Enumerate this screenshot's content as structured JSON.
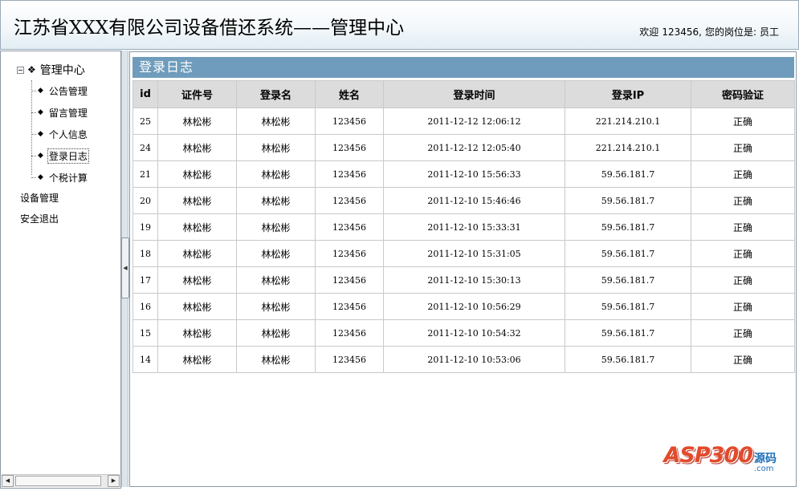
{
  "header": {
    "title": "江苏省XXX有限公司设备借还系统——管理中心",
    "welcome_prefix": "欢迎",
    "username": "123456,",
    "role_label": "您的岗位是:",
    "role_value": "员工"
  },
  "sidebar": {
    "root_label": "管理中心",
    "items": [
      {
        "label": "公告管理",
        "selected": false
      },
      {
        "label": "留言管理",
        "selected": false
      },
      {
        "label": "个人信息",
        "selected": false
      },
      {
        "label": "登录日志",
        "selected": true
      },
      {
        "label": "个税计算",
        "selected": false
      }
    ],
    "top_items": [
      "设备管理",
      "安全退出"
    ]
  },
  "main": {
    "section_title": "登录日志",
    "table": {
      "columns": [
        "id",
        "证件号",
        "登录名",
        "姓名",
        "登录时间",
        "登录IP",
        "密码验证"
      ],
      "rows": [
        [
          "25",
          "林松彬",
          "林松彬",
          "123456",
          "2011-12-12 12:06:12",
          "221.214.210.1",
          "正确"
        ],
        [
          "24",
          "林松彬",
          "林松彬",
          "123456",
          "2011-12-12 12:05:40",
          "221.214.210.1",
          "正确"
        ],
        [
          "21",
          "林松彬",
          "林松彬",
          "123456",
          "2011-12-10 15:56:33",
          "59.56.181.7",
          "正确"
        ],
        [
          "20",
          "林松彬",
          "林松彬",
          "123456",
          "2011-12-10 15:46:46",
          "59.56.181.7",
          "正确"
        ],
        [
          "19",
          "林松彬",
          "林松彬",
          "123456",
          "2011-12-10 15:33:31",
          "59.56.181.7",
          "正确"
        ],
        [
          "18",
          "林松彬",
          "林松彬",
          "123456",
          "2011-12-10 15:31:05",
          "59.56.181.7",
          "正确"
        ],
        [
          "17",
          "林松彬",
          "林松彬",
          "123456",
          "2011-12-10 15:30:13",
          "59.56.181.7",
          "正确"
        ],
        [
          "16",
          "林松彬",
          "林松彬",
          "123456",
          "2011-12-10 10:56:29",
          "59.56.181.7",
          "正确"
        ],
        [
          "15",
          "林松彬",
          "林松彬",
          "123456",
          "2011-12-10 10:54:32",
          "59.56.181.7",
          "正确"
        ],
        [
          "14",
          "林松彬",
          "林松彬",
          "123456",
          "2011-12-10 10:53:06",
          "59.56.181.7",
          "正确"
        ]
      ]
    }
  },
  "watermark": {
    "logo_text": "ASP300",
    "cn_text": "源码",
    "domain_text": ".com"
  },
  "icons": {
    "tree_toggle": "minus-box-icon",
    "tree_root": "four-diamonds-icon",
    "tree_leaf": "diamond-icon",
    "scroll_left": "arrow-left-icon",
    "scroll_right": "arrow-right-icon",
    "splitter": "collapse-left-icon"
  },
  "colors": {
    "section_bar": "#6f9cbc",
    "table_header": "#dcdcdc",
    "header_gradient_end": "#e2edf4"
  }
}
